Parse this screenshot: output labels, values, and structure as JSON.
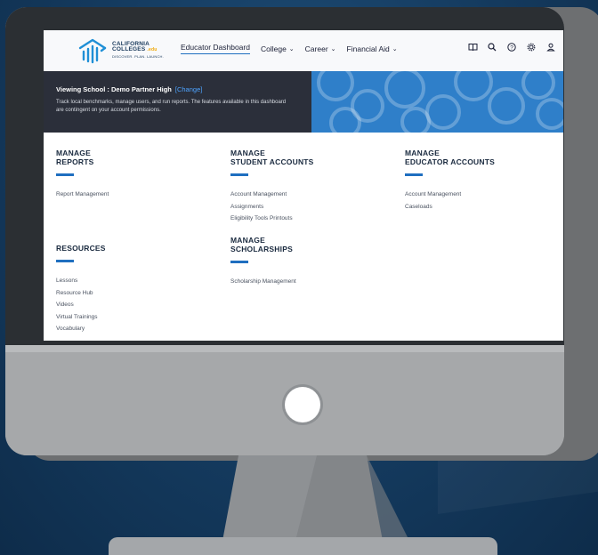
{
  "logo": {
    "line1": "CALIFORNIA",
    "line2": "COLLEGES",
    "edu": ".edu",
    "tagline": "DISCOVER. PLAN. LAUNCH."
  },
  "nav": {
    "items": [
      {
        "label": "Educator Dashboard"
      },
      {
        "label": "College"
      },
      {
        "label": "Career"
      },
      {
        "label": "Financial Aid"
      }
    ],
    "icons": [
      "book-icon",
      "search-icon",
      "help-icon",
      "gear-icon",
      "user-icon"
    ]
  },
  "banner": {
    "title": "Viewing School : Demo Partner High",
    "change_link": "[Change]",
    "text": "Track local benchmarks, manage users, and run reports. The features available in this dashboard are contingent on your account permissions."
  },
  "sections": {
    "reports": {
      "title1": "MANAGE",
      "title2": "REPORTS",
      "links": [
        "Report Management"
      ]
    },
    "student_accounts": {
      "title1": "MANAGE",
      "title2": "STUDENT ACCOUNTS",
      "links": [
        "Account Management",
        "Assignments",
        "Eligibility Tools Printouts"
      ]
    },
    "educator_accounts": {
      "title1": "MANAGE",
      "title2": "EDUCATOR ACCOUNTS",
      "links": [
        "Account Management",
        "Caseloads"
      ]
    },
    "resources": {
      "title": "RESOURCES",
      "links": [
        "Lessons",
        "Resource Hub",
        "Videos",
        "Virtual Trainings",
        "Vocabulary"
      ]
    },
    "scholarships": {
      "title1": "MANAGE",
      "title2": "SCHOLARSHIPS",
      "links": [
        "Scholarship Management"
      ]
    }
  },
  "colors": {
    "accent": "#1f6fc0",
    "banner_dark": "#2b2f3a",
    "banner_blue": "#2f7fc9",
    "page_bg": "#143a5e"
  }
}
